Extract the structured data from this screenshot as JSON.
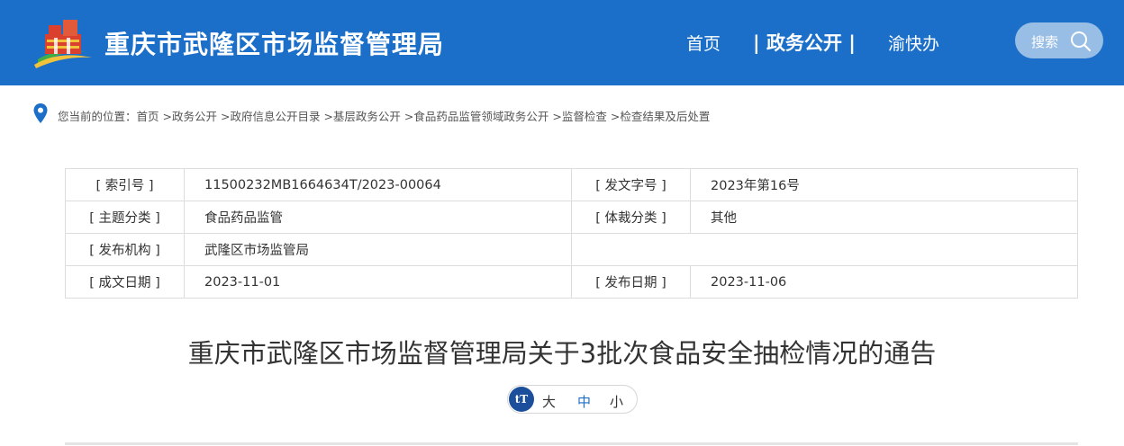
{
  "header": {
    "site_title": "重庆市武隆区市场监督管理局",
    "nav": {
      "home": "首页",
      "active": "| 政务公开 |",
      "yu": "渝快办"
    },
    "search_label": "搜索"
  },
  "breadcrumb": {
    "prefix": "您当前的位置：",
    "items": [
      "首页",
      ">政务公开",
      ">政府信息公开目录",
      ">基层政务公开",
      ">食品药品监管领域政务公开",
      ">监督检查",
      ">检查结果及后处置"
    ]
  },
  "info": {
    "rows": [
      {
        "l1": "[ 索引号 ]",
        "v1": "11500232MB1664634T/2023-00064",
        "l2": "[ 发文字号 ]",
        "v2": "2023年第16号"
      },
      {
        "l1": "[ 主题分类 ]",
        "v1": "食品药品监管",
        "l2": "[ 体裁分类 ]",
        "v2": "其他"
      },
      {
        "l1": "[ 发布机构 ]",
        "v1": "武隆区市场监管局"
      },
      {
        "l1": "[ 成文日期 ]",
        "v1": "2023-11-01",
        "l2": "[ 发布日期 ]",
        "v2": "2023-11-06"
      }
    ]
  },
  "doc_title": "重庆市武隆区市场监督管理局关于3批次食品安全抽检情况的通告",
  "font_switch": {
    "icon_text": "tT",
    "big": "大",
    "mid": "中",
    "small": "小"
  },
  "colors": {
    "header_bg": "#1b6fc8",
    "accent": "#1b6fc8",
    "tt_icon_bg": "#1b4f9c"
  }
}
